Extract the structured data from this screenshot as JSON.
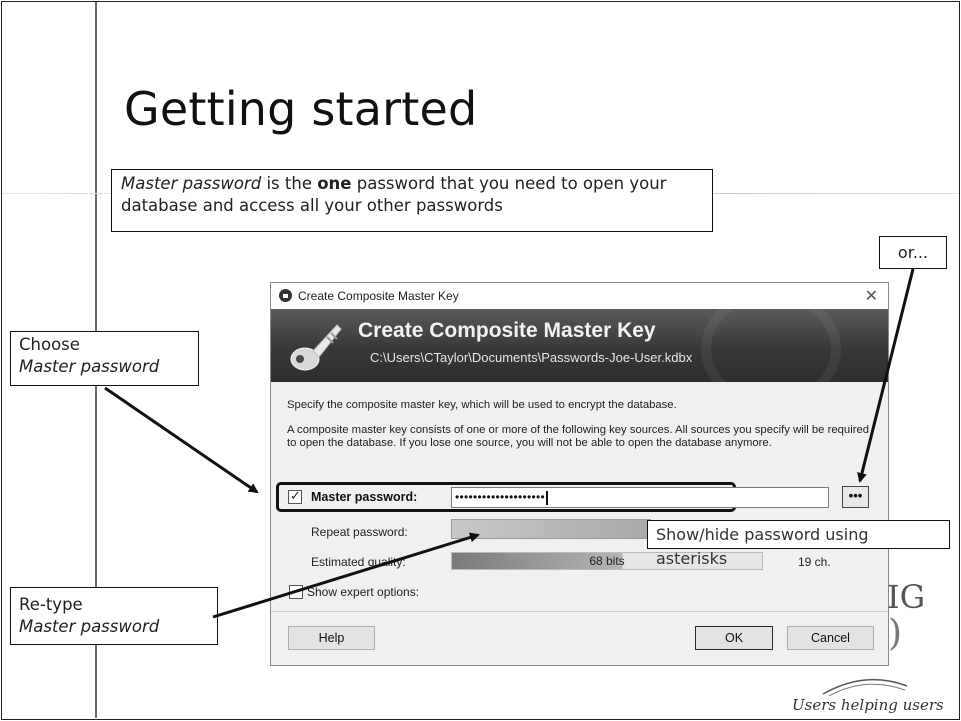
{
  "slide": {
    "title": "Getting started"
  },
  "callouts": {
    "intro": {
      "part1": "Master password",
      "part2": " is the ",
      "part3": "one",
      "part4": " password that you need to open your database and access all your other passwords"
    },
    "choose": {
      "line1": "Choose",
      "line2": "Master password"
    },
    "retype": {
      "line1": "Re-type",
      "line2": "Master password"
    },
    "or": "or...",
    "tooltip": "Show/hide password using asterisks"
  },
  "dialog": {
    "window_title": "Create Composite Master Key",
    "close_glyph": "✕",
    "banner_title": "Create Composite Master Key",
    "banner_path": "C:\\Users\\CTaylor\\Documents\\Passwords-Joe-User.kdbx",
    "desc1": "Specify the composite master key, which will be used to encrypt the database.",
    "desc2": "A composite master key consists of one or more of the following key sources. All sources you specify will be required to open the database. If you lose one source, you will not be able to open the database anymore.",
    "master_password": {
      "label": "Master password:",
      "checked": true,
      "value": "••••••••••••••••••••"
    },
    "toggle_button": "•••",
    "repeat_password": {
      "label": "Repeat password:",
      "value": ""
    },
    "quality": {
      "label": "Estimated quality:",
      "value": "68 bits",
      "chars": "19 ch.",
      "fill_fraction": 0.55
    },
    "expert": {
      "label": "Show expert options:",
      "checked": false
    },
    "buttons": {
      "help": "Help",
      "ok": "OK",
      "cancel": "Cancel"
    }
  },
  "logo": {
    "letters": "IG",
    "tagline": "Users helping users"
  },
  "colors": {
    "banner_dark": "#383838",
    "callout_border": "#111111",
    "dialog_bg": "#f0f0f0"
  }
}
